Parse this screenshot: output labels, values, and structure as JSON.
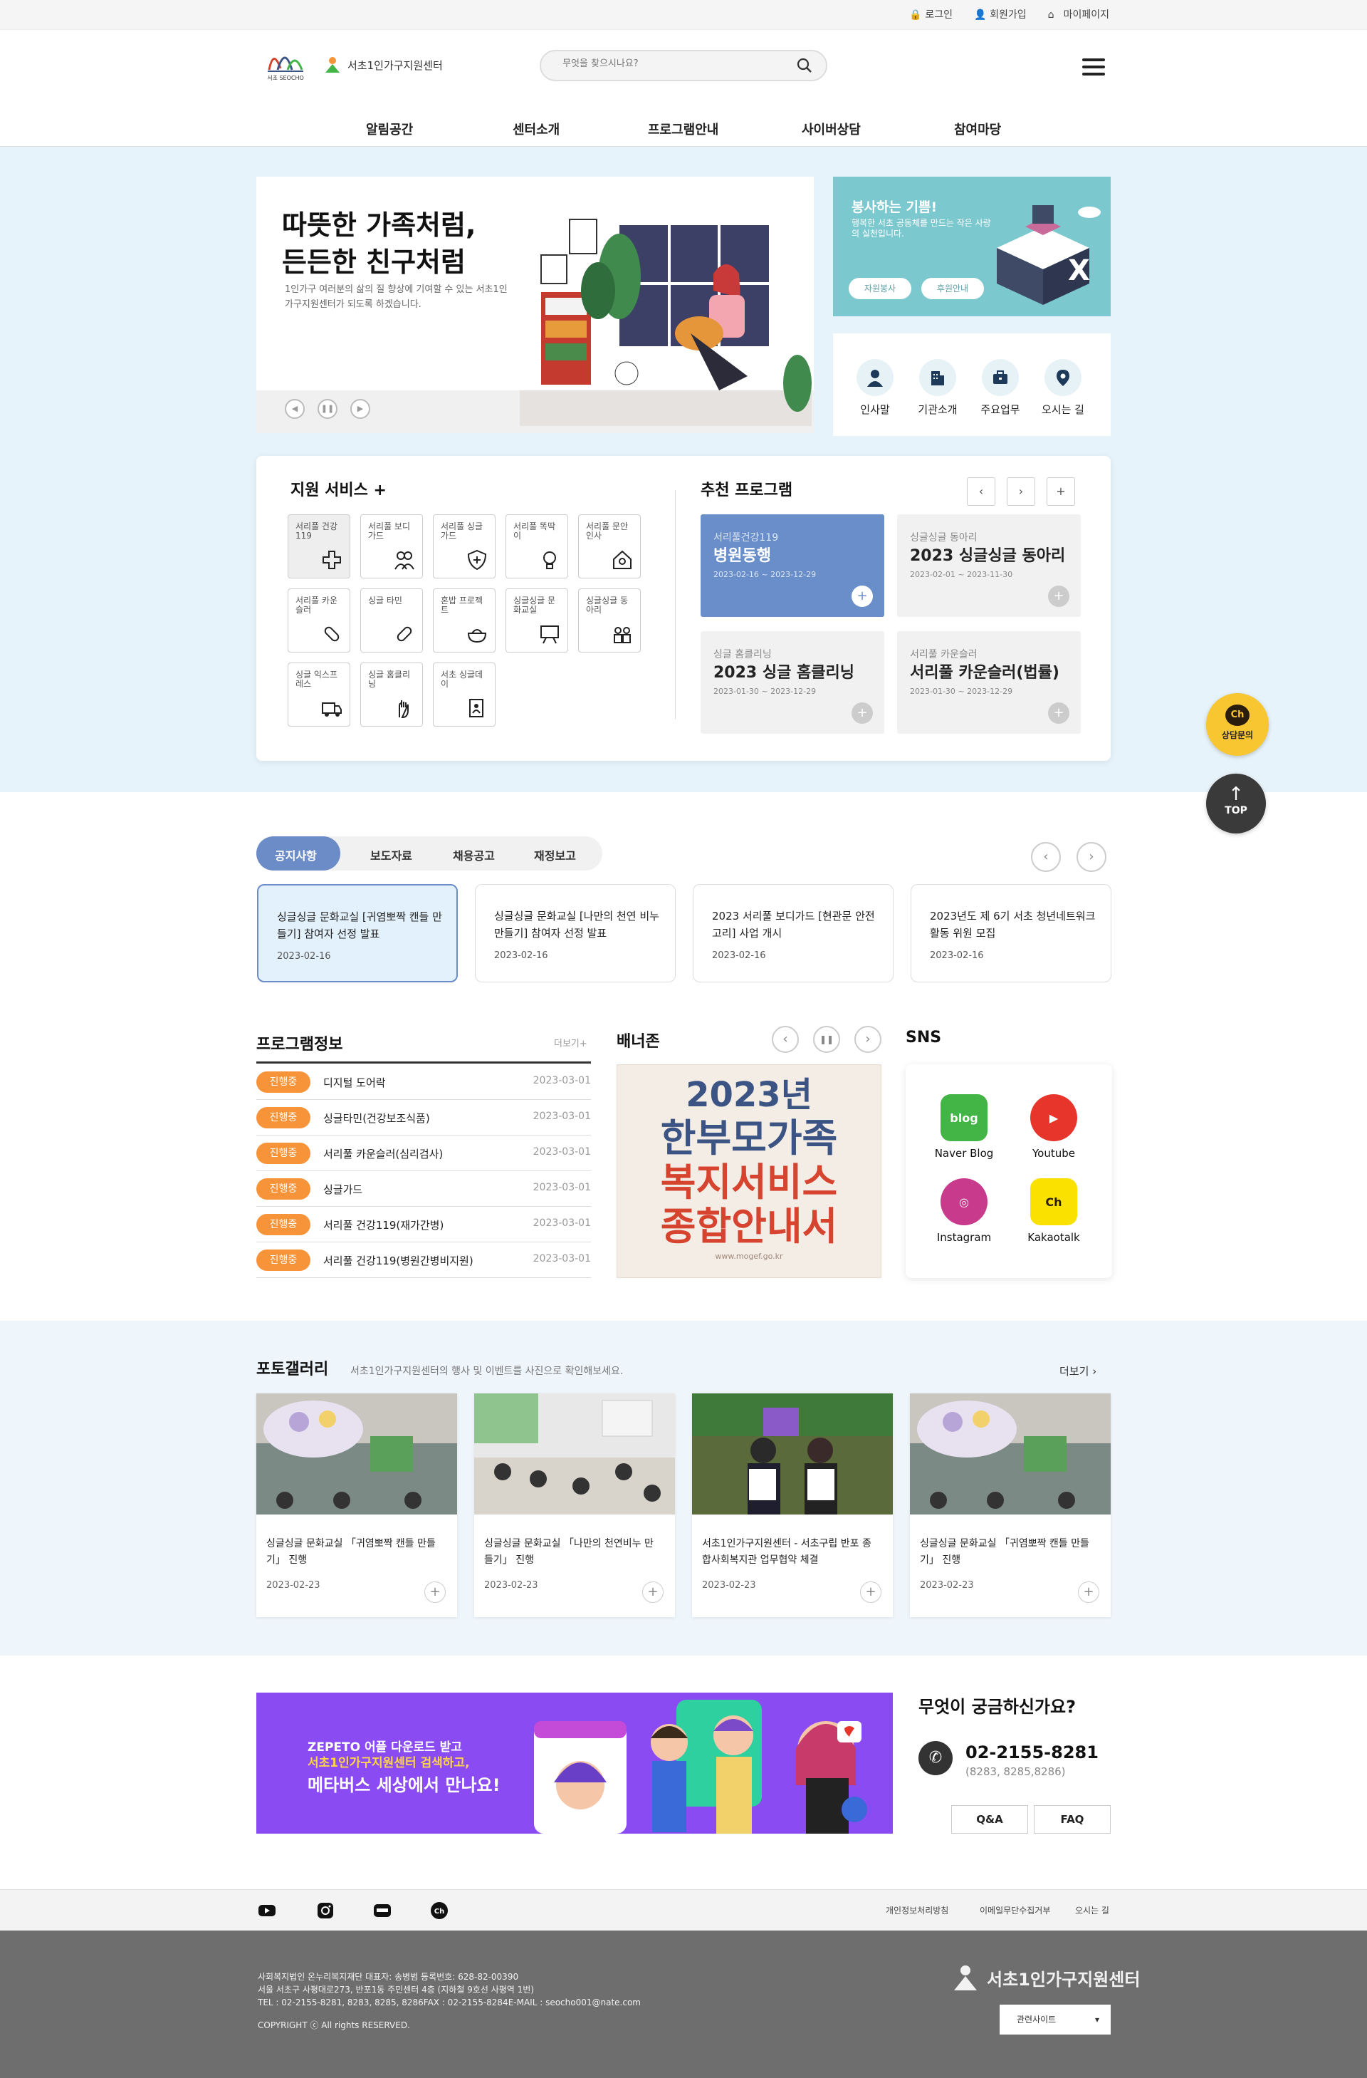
{
  "util": {
    "login": "로그인",
    "join": "회원가입",
    "mypage": "마이페이지"
  },
  "header": {
    "logo_org": "서초 SEOCHO",
    "logo_center": "서초1인가구지원센터",
    "search_placeholder": "무엇을 찾으시나요?",
    "gnb": [
      "알림공간",
      "센터소개",
      "프로그램안내",
      "사이버상담",
      "참여마당"
    ]
  },
  "visual": {
    "headline1": "따뜻한 가족처럼,",
    "headline2": "든든한 친구처럼",
    "desc": "1인가구 여러분의 삶의 질 향상에 기여할 수 있는 서초1인가구지원센터가 되도록 하겠습니다."
  },
  "volunteer": {
    "title": "봉사하는 기쁨!",
    "desc": "행복한 서초 공동체를 만드는 작은 사랑의 실천입니다.",
    "btn1": "자원봉사",
    "btn2": "후원안내"
  },
  "quick": [
    "인사말",
    "기관소개",
    "주요업무",
    "오시는 길"
  ],
  "services": {
    "title": "지원 서비스 +",
    "items": [
      "서리풀 건강119",
      "서리풀 보디가드",
      "서리풀 싱글가드",
      "서리풀 똑딱이",
      "서리풀 문안인사",
      "서리풀 카운슬러",
      "싱글 타민",
      "혼밥 프로젝트",
      "싱글싱글 문화교실",
      "싱글싱글 동아리",
      "싱글 익스프레스",
      "싱글 홈클리닝",
      "서초 싱글데이"
    ]
  },
  "recommend": {
    "title": "추천 프로그램",
    "items": [
      {
        "cat": "서리풀건강119",
        "title": "병원동행",
        "date": "2023-02-16 ~ 2023-12-29"
      },
      {
        "cat": "싱글싱글 동아리",
        "title": "2023 싱글싱글 동아리",
        "date": "2023-02-01 ~ 2023-11-30"
      },
      {
        "cat": "싱글 홈클리닝",
        "title": "2023 싱글 홈클리닝",
        "date": "2023-01-30 ~ 2023-12-29"
      },
      {
        "cat": "서리풀 카운슬러",
        "title": "서리풀 카운슬러(법률)",
        "date": "2023-01-30 ~ 2023-12-29"
      }
    ]
  },
  "floating": {
    "chat": "상담문의",
    "top": "TOP"
  },
  "notice": {
    "tabs": [
      "공지사항",
      "보도자료",
      "채용공고",
      "재정보고"
    ],
    "items": [
      {
        "title": "싱글싱글 문화교실 [귀염뽀짝 캔들 만들기] 참여자 선정 발표",
        "date": "2023-02-16"
      },
      {
        "title": "싱글싱글 문화교실 [나만의 천연 비누 만들기] 참여자 선정 발표",
        "date": "2023-02-16"
      },
      {
        "title": "2023 서리풀 보디가드 [현관문 안전고리] 사업 개시",
        "date": "2023-02-16"
      },
      {
        "title": "2023년도 제 6기 서초 청년네트워크 활동 위원 모집",
        "date": "2023-02-16"
      }
    ]
  },
  "program_info": {
    "title": "프로그램정보",
    "more": "더보기+",
    "rows": [
      {
        "status": "진행중",
        "title": "디지털 도어락",
        "date": "2023-03-01"
      },
      {
        "status": "진행중",
        "title": "싱글타민(건강보조식품)",
        "date": "2023-03-01"
      },
      {
        "status": "진행중",
        "title": "서리풀 카운슬러(심리검사)",
        "date": "2023-03-01"
      },
      {
        "status": "진행중",
        "title": "싱글가드",
        "date": "2023-03-01"
      },
      {
        "status": "진행중",
        "title": "서리풀 건강119(재가간병)",
        "date": "2023-03-01"
      },
      {
        "status": "진행중",
        "title": "서리풀 건강119(병원간병비지원)",
        "date": "2023-03-01"
      }
    ]
  },
  "banner_zone": {
    "title": "배너존",
    "line1": "2023년",
    "line2": "한부모가족",
    "line3": "복지서비스",
    "line4": "종합안내서",
    "url": "www.mogef.go.kr"
  },
  "sns": {
    "title": "SNS",
    "items": [
      {
        "name": "Naver Blog",
        "color": "#43b546"
      },
      {
        "name": "Youtube",
        "color": "#e8352c"
      },
      {
        "name": "Instagram",
        "color": "#c83a8c"
      },
      {
        "name": "Kakaotalk",
        "color": "#fae100"
      }
    ]
  },
  "gallery": {
    "title": "포토갤러리",
    "desc": "서초1인가구지원센터의 행사 및 이벤트를 사진으로 확인해보세요.",
    "more": "더보기",
    "items": [
      {
        "title": "싱글싱글 문화교실 「귀염뽀짝 캔들 만들기」 진행",
        "date": "2023-02-23"
      },
      {
        "title": "싱글싱글 문화교실 「나만의 천연비누 만들기」 진행",
        "date": "2023-02-23"
      },
      {
        "title": "서초1인가구지원센터 - 서초구립 반포 종합사회복지관 업무협약 체결",
        "date": "2023-02-23"
      },
      {
        "title": "싱글싱글 문화교실 「귀염뽀짝 캔들 만들기」 진행",
        "date": "2023-02-23"
      }
    ]
  },
  "zepeto": {
    "line1": "ZEPETO 어플 다운로드 받고",
    "line2": "서초1인가구지원센터 검색하고,",
    "line3": "메타버스 세상에서 만나요!"
  },
  "faq": {
    "title": "무엇이 궁금하신가요?",
    "phone": "02-2155-8281",
    "sub": "(8283, 8285,8286)",
    "btn_qa": "Q&A",
    "btn_faq": "FAQ"
  },
  "footer": {
    "links": [
      "개인정보처리방침",
      "이메일무단수집거부",
      "오시는 길"
    ],
    "info1": "사회복지법인 온누리복지재단 대표자: 송병범 등록번호: 628-82-00390",
    "info2": "서울 서초구 사평대로273, 반포1동 주민센터 4층 (지하철 9호선 사평역 1번)",
    "info3": "TEL : 02-2155-8281, 8283, 8285, 8286FAX : 02-2155-8284E-MAIL : seocho001@nate.com",
    "copyright": "COPYRIGHT ⓒ All rights RESERVED.",
    "logo": "서초1인가구지원센터",
    "related": "관련사이트"
  }
}
